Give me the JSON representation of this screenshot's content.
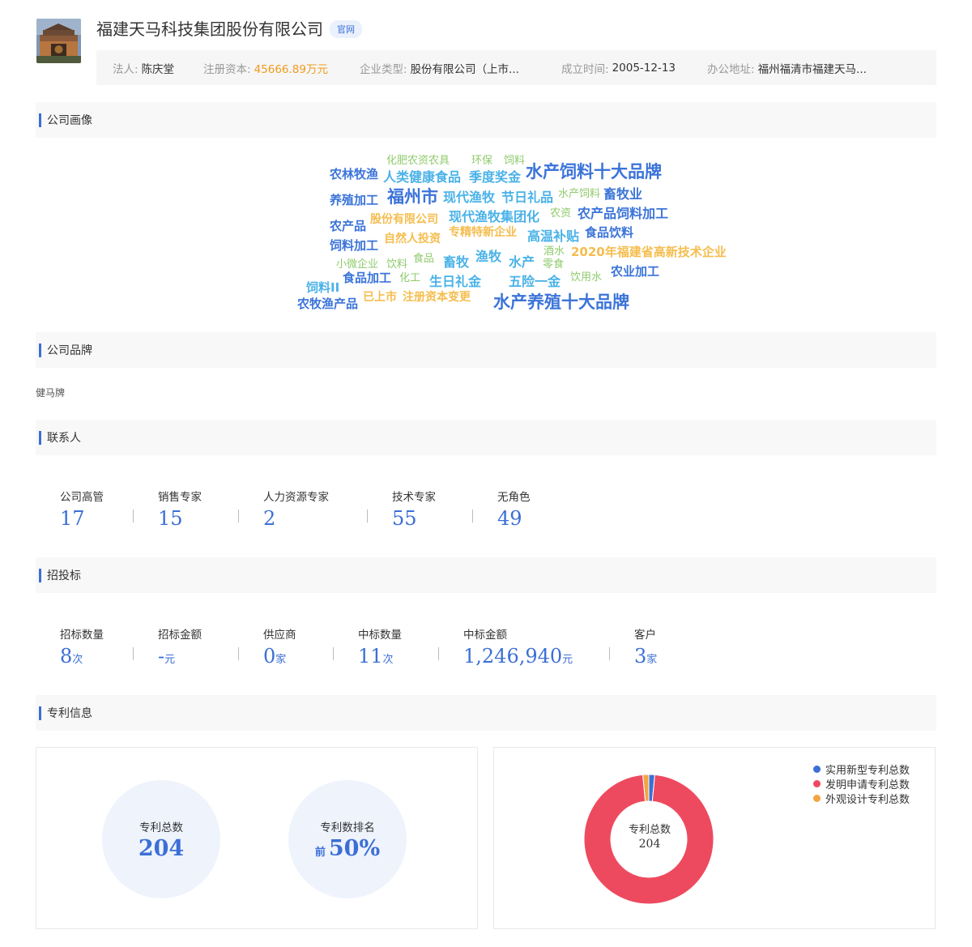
{
  "company": {
    "name": "福建天马科技集团股份有限公司",
    "official_site_label": "官网",
    "info": {
      "legal_rep_label": "法人:",
      "legal_rep": "陈庆堂",
      "capital_label": "注册资本:",
      "capital": "45666.89万元",
      "type_label": "企业类型:",
      "type": "股份有限公司（上市...",
      "founded_label": "成立时间:",
      "founded": "2005-12-13",
      "address_label": "办公地址:",
      "address": "福州福清市福建天马..."
    }
  },
  "sections": {
    "portrait": "公司画像",
    "brand": "公司品牌",
    "contacts": "联系人",
    "bidding": "招投标",
    "patents": "专利信息"
  },
  "wordcloud": [
    {
      "text": "化肥农资农具",
      "color": "green"
    },
    {
      "text": "环保",
      "color": "green"
    },
    {
      "text": "饲料",
      "color": "green"
    },
    {
      "text": "农林牧渔",
      "color": "blue"
    },
    {
      "text": "人类健康食品",
      "color": "sky"
    },
    {
      "text": "季度奖金",
      "color": "sky"
    },
    {
      "text": "水产饲料十大品牌",
      "color": "blue"
    },
    {
      "text": "养殖加工",
      "color": "blue"
    },
    {
      "text": "福州市",
      "color": "blue"
    },
    {
      "text": "现代渔牧",
      "color": "sky"
    },
    {
      "text": "节日礼品",
      "color": "sky"
    },
    {
      "text": "水产饲料",
      "color": "green"
    },
    {
      "text": "畜牧业",
      "color": "blue"
    },
    {
      "text": "农产品",
      "color": "blue"
    },
    {
      "text": "股份有限公司",
      "color": "orange"
    },
    {
      "text": "现代渔牧集团化",
      "color": "sky"
    },
    {
      "text": "农资",
      "color": "green"
    },
    {
      "text": "农产品饲料加工",
      "color": "blue"
    },
    {
      "text": "饲料加工",
      "color": "blue"
    },
    {
      "text": "自然人投资",
      "color": "orange"
    },
    {
      "text": "专精特新企业",
      "color": "orange"
    },
    {
      "text": "高温补贴",
      "color": "sky"
    },
    {
      "text": "食品饮料",
      "color": "blue"
    },
    {
      "text": "酒水",
      "color": "green"
    },
    {
      "text": "2020年福建省高新技术企业",
      "color": "orange"
    },
    {
      "text": "小微企业",
      "color": "green"
    },
    {
      "text": "饮料",
      "color": "green"
    },
    {
      "text": "食品",
      "color": "green"
    },
    {
      "text": "畜牧",
      "color": "sky"
    },
    {
      "text": "渔牧",
      "color": "sky"
    },
    {
      "text": "水产",
      "color": "sky"
    },
    {
      "text": "零食",
      "color": "green"
    },
    {
      "text": "农业加工",
      "color": "blue"
    },
    {
      "text": "饲料II",
      "color": "sky"
    },
    {
      "text": "食品加工",
      "color": "blue"
    },
    {
      "text": "化工",
      "color": "green"
    },
    {
      "text": "生日礼金",
      "color": "sky"
    },
    {
      "text": "五险一金",
      "color": "sky"
    },
    {
      "text": "饮用水",
      "color": "green"
    },
    {
      "text": "农牧渔产品",
      "color": "blue"
    },
    {
      "text": "已上市",
      "color": "orange"
    },
    {
      "text": "注册资本变更",
      "color": "orange"
    },
    {
      "text": "水产养殖十大品牌",
      "color": "blue"
    }
  ],
  "brand": {
    "name": "健马牌"
  },
  "contacts": [
    {
      "label": "公司高管",
      "value": "17"
    },
    {
      "label": "销售专家",
      "value": "15"
    },
    {
      "label": "人力资源专家",
      "value": "2"
    },
    {
      "label": "技术专家",
      "value": "55"
    },
    {
      "label": "无角色",
      "value": "49"
    }
  ],
  "bidding": [
    {
      "label": "招标数量",
      "value": "8",
      "unit": "次"
    },
    {
      "label": "招标金额",
      "value": "-",
      "unit": "元"
    },
    {
      "label": "供应商",
      "value": "0",
      "unit": "家"
    },
    {
      "label": "中标数量",
      "value": "11",
      "unit": "次"
    },
    {
      "label": "中标金额",
      "value": "1,246,940",
      "unit": "元"
    },
    {
      "label": "客户",
      "value": "3",
      "unit": "家"
    }
  ],
  "patents": {
    "total_label": "专利总数",
    "total": "204",
    "rank_label": "专利数排名",
    "rank_prefix": "前",
    "rank": "50%",
    "donut_center_label": "专利总数",
    "donut_center_value": "204",
    "legend": [
      {
        "label": "实用新型专利总数",
        "color": "#3b6fd6"
      },
      {
        "label": "发明申请专利总数",
        "color": "#ee4a5f"
      },
      {
        "label": "外观设计专利总数",
        "color": "#f2a541"
      }
    ]
  },
  "chart_data": {
    "type": "pie",
    "categories": [
      "实用新型专利总数",
      "发明申请专利总数",
      "外观设计专利总数"
    ],
    "values": [
      3,
      198,
      3
    ],
    "colors": [
      "#3b6fd6",
      "#ee4a5f",
      "#f2a541"
    ],
    "legend_position": "top-right"
  }
}
